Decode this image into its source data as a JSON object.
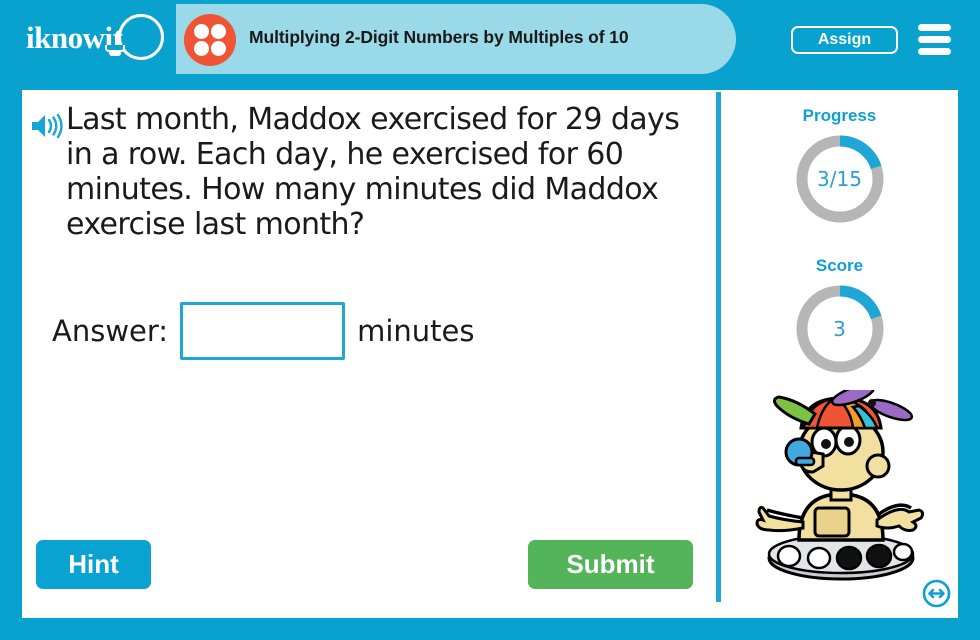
{
  "header": {
    "logo_text": "iknowit",
    "logo_icon": "lightbulb-icon",
    "topic_icon": "four-dots-circle-icon",
    "lesson_title": "Multiplying 2-Digit Numbers by Multiples of 10",
    "assign_label": "Assign",
    "menu_icon": "hamburger-menu-icon",
    "bar_color": "#09a2cf",
    "pill_color": "#9ad9e8",
    "topic_icon_color": "#ef5534"
  },
  "question": {
    "speaker_icon": "speaker-audio-icon",
    "text": "Last month, Maddox exercised for 29 days in a row. Each day, he exercised for 60 minutes. How many minutes did Maddox exercise last month?"
  },
  "answer": {
    "label": "Answer:",
    "value": "",
    "placeholder": "",
    "unit": "minutes",
    "border_color": "#1ea7d4"
  },
  "actions": {
    "hint_label": "Hint",
    "hint_color": "#0aa2d1",
    "submit_label": "Submit",
    "submit_color": "#53b45a"
  },
  "sidebar": {
    "progress": {
      "label": "Progress",
      "value": "3/15",
      "current": 3,
      "total": 15,
      "percent": 20,
      "arc_color": "#1ea7d4",
      "track_color": "#b6b6b6"
    },
    "score": {
      "label": "Score",
      "value": "3",
      "percent": 20,
      "arc_color": "#1ea7d4",
      "track_color": "#b6b6b6"
    },
    "mascot_icon": "robot-mascot-propeller-hat",
    "resize_icon": "resize-horizontal-icon",
    "resize_color": "#0aa2d1"
  }
}
